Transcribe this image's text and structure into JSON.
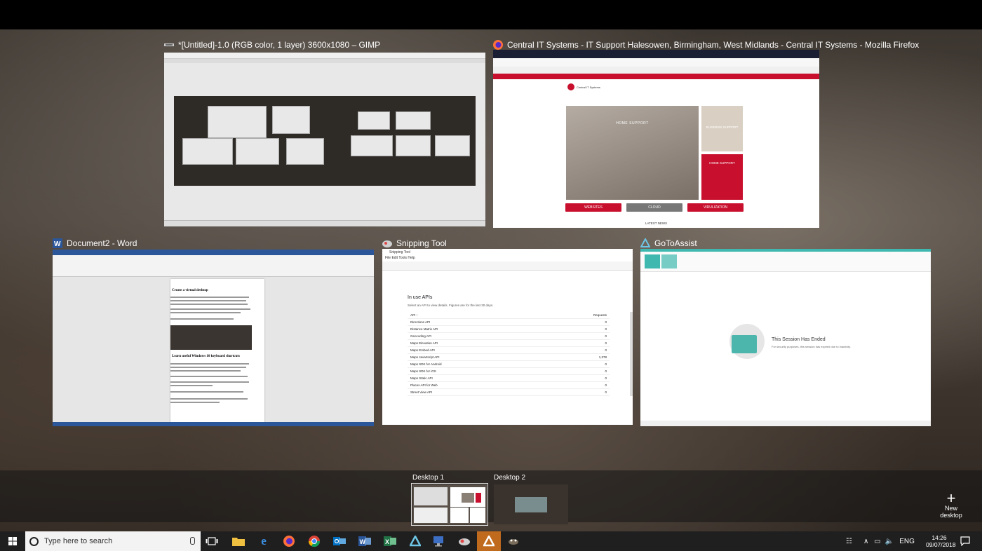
{
  "windows": {
    "gimp": {
      "title": "*[Untitled]-1.0 (RGB color, 1 layer) 3600x1080 – GIMP"
    },
    "firefox": {
      "title": "Central IT Systems - IT Support Halesowen, Birmingham, West Midlands - Central IT Systems - Mozilla Firefox",
      "hero_text": "HOME SUPPORT",
      "side_text_1": "BUSINESS SUPPORT",
      "side_text_2": "HOME SUPPORT",
      "logo_text": "Central IT Systems",
      "buttons": [
        "WEBSITES",
        "CLOUD",
        "VIRULIZATION"
      ],
      "latest_news": "LATEST NEWS"
    },
    "word": {
      "title": "Document2 - Word",
      "heading_1": "Create a virtual desktop",
      "heading_2": "Learn useful Windows 10 keyboard shortcuts"
    },
    "snipping": {
      "title": "Snipping Tool",
      "inner_title": "Snipping Tool",
      "menu": "File   Edit   Tools   Help",
      "heading": "In use APIs",
      "subheading": "Select an API to view details. Figures are for the last 30 days.",
      "col_api": "API ↑",
      "col_requests": "Requests",
      "rows": [
        {
          "api": "Directions API",
          "requests": "0"
        },
        {
          "api": "Distance Matrix API",
          "requests": "0"
        },
        {
          "api": "Geocoding API",
          "requests": "0"
        },
        {
          "api": "Maps Elevation API",
          "requests": "0"
        },
        {
          "api": "Maps Embed API",
          "requests": "0"
        },
        {
          "api": "Maps JavaScript API",
          "requests": "1,378"
        },
        {
          "api": "Maps SDK for Android",
          "requests": "0"
        },
        {
          "api": "Maps SDK for iOS",
          "requests": "0"
        },
        {
          "api": "Maps Static API",
          "requests": "0"
        },
        {
          "api": "Places API for Web",
          "requests": "0"
        },
        {
          "api": "Street View API",
          "requests": "0"
        }
      ]
    },
    "gotoassist": {
      "title": "GoToAssist",
      "ended_title": "This Session Has Ended",
      "ended_sub": "For security purposes, this session has expired due to inactivity."
    }
  },
  "desktops": [
    {
      "label": "Desktop 1"
    },
    {
      "label": "Desktop 2"
    }
  ],
  "new_desktop": {
    "label": "New desktop",
    "symbol": "+"
  },
  "taskbar": {
    "search_placeholder": "Type here to search",
    "tray_lang": "ENG",
    "time": "14:26",
    "date": "09/07/2018"
  },
  "colors": {
    "accent_red": "#c8102e",
    "word_blue": "#2b579a",
    "gta_teal": "#3fb8af",
    "taskbar": "#1f1f1f"
  }
}
